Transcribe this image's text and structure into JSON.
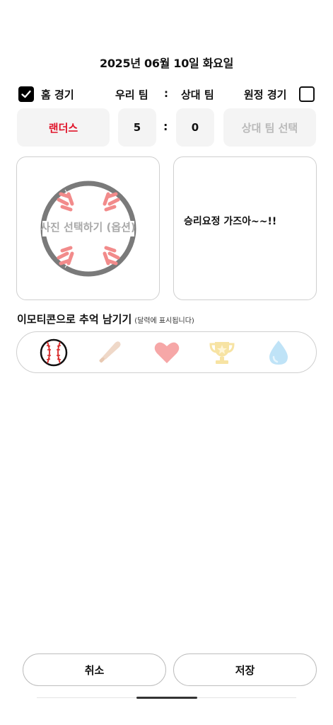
{
  "header": {
    "date": "2025년 06월 10일 화요일"
  },
  "match": {
    "home_game_label": "홈 경기",
    "home_game_checked": true,
    "our_team_label": "우리 팀",
    "separator": ":",
    "opponent_label": "상대 팀",
    "away_game_label": "원정 경기",
    "away_game_checked": false,
    "our_team": "랜더스",
    "our_score": "5",
    "opponent_score": "0",
    "opponent_placeholder": "상대 팀 선택"
  },
  "photo": {
    "label": "사진 선택하기 (옵션)",
    "icon": "baseball-icon"
  },
  "memo": {
    "text": "승리요정 가즈아~~!!"
  },
  "emoji_section": {
    "title": "이모티콘으로 추억 남기기",
    "subtitle": "(달력에 표시됩니다)",
    "items": [
      {
        "icon": "baseball-icon",
        "selected": true
      },
      {
        "icon": "bat-icon",
        "selected": false
      },
      {
        "icon": "heart-icon",
        "selected": false
      },
      {
        "icon": "trophy-icon",
        "selected": false
      },
      {
        "icon": "water-drop-icon",
        "selected": false
      }
    ]
  },
  "actions": {
    "cancel_label": "취소",
    "save_label": "저장"
  },
  "colors": {
    "team": "#e0152b",
    "card_border": "#cfcfcf",
    "box_bg": "#f4f4f4"
  }
}
